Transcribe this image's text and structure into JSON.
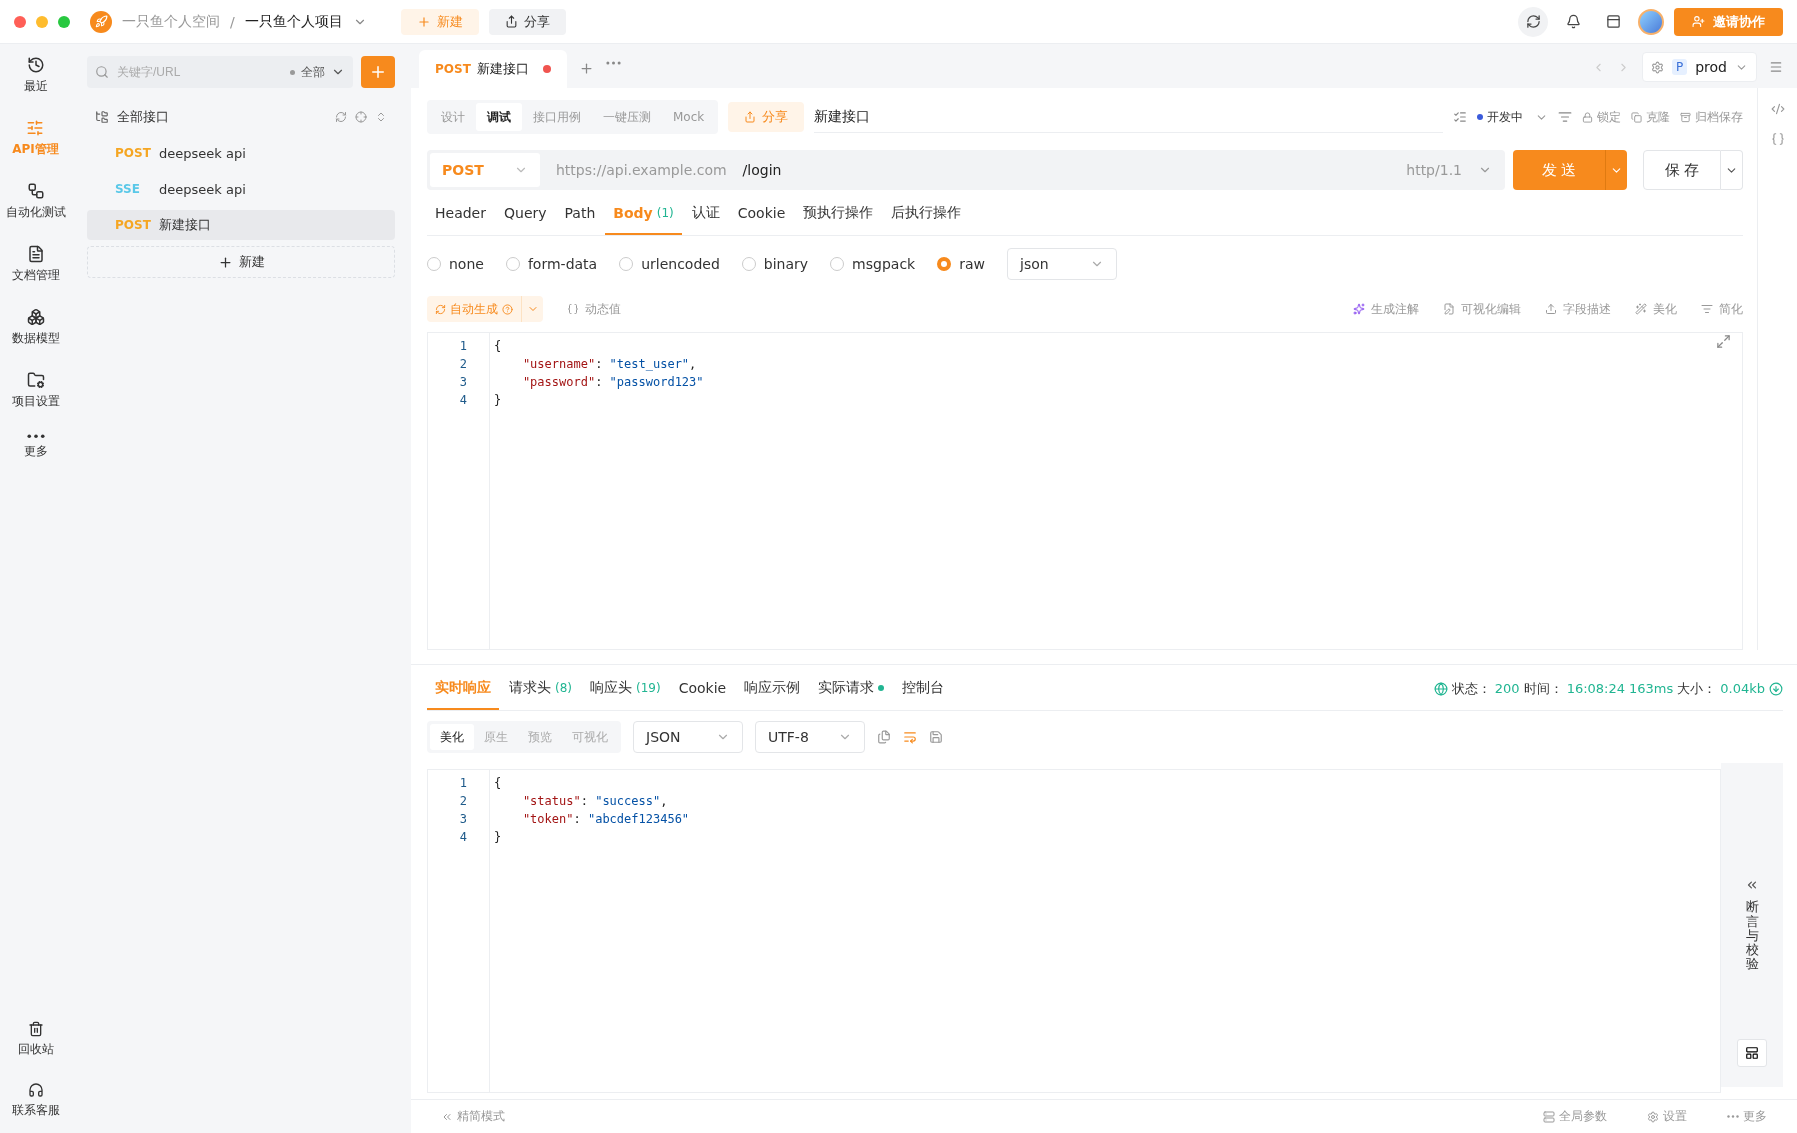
{
  "window": {
    "space": "一只鱼个人空间",
    "separator": "/",
    "project": "一只鱼个人项目"
  },
  "top_actions": [
    {
      "label": "新建",
      "kind": "primary"
    },
    {
      "label": "分享",
      "kind": "plain"
    }
  ],
  "invite_button": "邀请协作",
  "nav": {
    "items": [
      {
        "label": "最近",
        "selected": false
      },
      {
        "label": "API管理",
        "selected": true
      },
      {
        "label": "自动化测试",
        "selected": false
      },
      {
        "label": "文档管理",
        "selected": false
      },
      {
        "label": "数据模型",
        "selected": false
      },
      {
        "label": "项目设置",
        "selected": false
      },
      {
        "label": "更多",
        "selected": false
      }
    ],
    "bottom_items": [
      "回收站",
      "联系客服"
    ]
  },
  "sidebar": {
    "search_placeholder": "关键字/URL",
    "filter": "全部",
    "tree_root": "全部接口",
    "items": [
      {
        "method": "POST",
        "color": "#f5a623",
        "name": "deepseek api",
        "selected": false
      },
      {
        "method": "SSE",
        "color": "#5ac8e8",
        "name": "deepseek api",
        "selected": false
      },
      {
        "method": "POST",
        "color": "#f5a623",
        "name": "新建接口",
        "selected": true
      }
    ],
    "new_label": "新建"
  },
  "doc_tabs": [
    {
      "method": "POST",
      "title": "新建接口",
      "unsaved": true,
      "selected": true
    }
  ],
  "env": {
    "badge": "P",
    "name": "prod"
  },
  "mode_tabs": [
    {
      "label": "设计",
      "selected": false
    },
    {
      "label": "调试",
      "selected": true
    },
    {
      "label": "接口用例",
      "selected": false
    },
    {
      "label": "一键压测",
      "selected": false
    },
    {
      "label": "Mock",
      "selected": false
    }
  ],
  "share_button": "分享",
  "api_name": "新建接口",
  "status": "开发中",
  "api_actions": [
    "锁定",
    "克隆",
    "归档保存"
  ],
  "request": {
    "method": "POST",
    "base_url": "https://api.example.com",
    "path": "/login",
    "protocol": "http/1.1",
    "send": "发 送",
    "save": "保 存"
  },
  "request_tabs": [
    {
      "label": "Header",
      "selected": false
    },
    {
      "label": "Query",
      "selected": false
    },
    {
      "label": "Path",
      "selected": false
    },
    {
      "label": "Body",
      "count": "(1)",
      "selected": true
    },
    {
      "label": "认证",
      "selected": false
    },
    {
      "label": "Cookie",
      "selected": false
    },
    {
      "label": "预执行操作",
      "selected": false
    },
    {
      "label": "后执行操作",
      "selected": false
    }
  ],
  "body_types": [
    {
      "label": "none",
      "selected": false
    },
    {
      "label": "form-data",
      "selected": false
    },
    {
      "label": "urlencoded",
      "selected": false
    },
    {
      "label": "binary",
      "selected": false
    },
    {
      "label": "msgpack",
      "selected": false
    },
    {
      "label": "raw",
      "selected": true
    }
  ],
  "body_format": "json",
  "auto_generate": "自动生成",
  "dynamic_value": "动态值",
  "body_tools": [
    "生成注解",
    "可视化编辑",
    "字段描述",
    "美化",
    "简化"
  ],
  "body_code": [
    {
      "number": "1",
      "tokens": [
        {
          "kind": "punct",
          "text": "{"
        }
      ]
    },
    {
      "number": "2",
      "tokens": [
        {
          "kind": "key",
          "text": "    \"username\""
        },
        {
          "kind": "punct",
          "text": ": "
        },
        {
          "kind": "string",
          "text": "\"test_user\""
        },
        {
          "kind": "punct",
          "text": ","
        }
      ]
    },
    {
      "number": "3",
      "tokens": [
        {
          "kind": "key",
          "text": "    \"password\""
        },
        {
          "kind": "punct",
          "text": ": "
        },
        {
          "kind": "string",
          "text": "\"password123\""
        }
      ]
    },
    {
      "number": "4",
      "tokens": [
        {
          "kind": "punct",
          "text": "}"
        }
      ]
    }
  ],
  "response_tabs": [
    {
      "label": "实时响应",
      "dot": false,
      "selected": true
    },
    {
      "label": "请求头",
      "count": "(8)",
      "dot": false,
      "selected": false
    },
    {
      "label": "响应头",
      "count": "(19)",
      "dot": false,
      "selected": false
    },
    {
      "label": "Cookie",
      "dot": false,
      "selected": false
    },
    {
      "label": "响应示例",
      "dot": false,
      "selected": false
    },
    {
      "label": "实际请求",
      "dot": true,
      "selected": false
    },
    {
      "label": "控制台",
      "dot": false,
      "selected": false
    }
  ],
  "response_meta": {
    "status_label": "状态：",
    "status": "200",
    "time_label": "时间：",
    "time": "16:08:24",
    "duration": "163ms",
    "size_label": "大小：",
    "size": "0.04kb"
  },
  "view_tabs": [
    {
      "label": "美化",
      "selected": true
    },
    {
      "label": "原生",
      "selected": false
    },
    {
      "label": "预览",
      "selected": false
    },
    {
      "label": "可视化",
      "selected": false
    }
  ],
  "response_format": "JSON",
  "encoding": "UTF-8",
  "response_code": [
    {
      "number": "1",
      "tokens": [
        {
          "kind": "punct",
          "text": "{"
        }
      ]
    },
    {
      "number": "2",
      "tokens": [
        {
          "kind": "key",
          "text": "    \"status\""
        },
        {
          "kind": "punct",
          "text": ": "
        },
        {
          "kind": "string",
          "text": "\"success\""
        },
        {
          "kind": "punct",
          "text": ","
        }
      ]
    },
    {
      "number": "3",
      "tokens": [
        {
          "kind": "key",
          "text": "    \"token\""
        },
        {
          "kind": "punct",
          "text": ": "
        },
        {
          "kind": "string",
          "text": "\"abcdef123456\""
        }
      ]
    },
    {
      "number": "4",
      "tokens": [
        {
          "kind": "punct",
          "text": "}"
        }
      ]
    }
  ],
  "assert_panel": "断言与校验",
  "footer": {
    "left": "精简模式",
    "right": [
      "全局参数",
      "设置",
      "更多"
    ]
  }
}
